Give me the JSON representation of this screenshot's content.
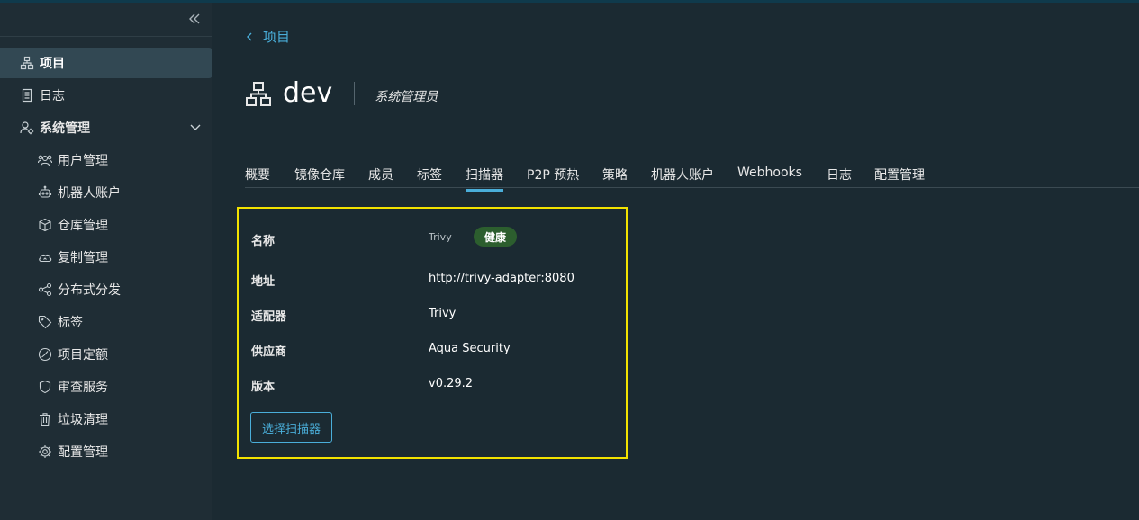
{
  "sidebar": {
    "items": [
      {
        "label": "项目",
        "icon": "project-icon"
      },
      {
        "label": "日志",
        "icon": "log-icon"
      },
      {
        "label": "系统管理",
        "icon": "admin-icon"
      },
      {
        "label": "用户管理",
        "icon": "users-icon"
      },
      {
        "label": "机器人账户",
        "icon": "robot-icon"
      },
      {
        "label": "仓库管理",
        "icon": "cube-icon"
      },
      {
        "label": "复制管理",
        "icon": "cloud-icon"
      },
      {
        "label": "分布式分发",
        "icon": "share-icon"
      },
      {
        "label": "标签",
        "icon": "tag-icon"
      },
      {
        "label": "项目定额",
        "icon": "gauge-icon"
      },
      {
        "label": "审查服务",
        "icon": "shield-icon"
      },
      {
        "label": "垃圾清理",
        "icon": "trash-icon"
      },
      {
        "label": "配置管理",
        "icon": "gear-icon"
      }
    ]
  },
  "breadcrumb": {
    "back_label": "项目"
  },
  "header": {
    "project_name": "dev",
    "role": "系统管理员"
  },
  "tabs": [
    "概要",
    "镜像仓库",
    "成员",
    "标签",
    "扫描器",
    "P2P 预热",
    "策略",
    "机器人账户",
    "Webhooks",
    "日志",
    "配置管理"
  ],
  "active_tab": "扫描器",
  "scanner": {
    "name_label": "名称",
    "name_value": "Trivy",
    "status": "健康",
    "address_label": "地址",
    "address_value": "http://trivy-adapter:8080",
    "adapter_label": "适配器",
    "adapter_value": "Trivy",
    "vendor_label": "供应商",
    "vendor_value": "Aqua Security",
    "version_label": "版本",
    "version_value": "v0.29.2",
    "select_button": "选择扫描器"
  },
  "colors": {
    "accent": "#4aaed9",
    "background": "#1b2a32",
    "sidebar": "#1f2d35",
    "highlight_border": "#f2e200",
    "healthy_badge": "#2c5e2e"
  }
}
